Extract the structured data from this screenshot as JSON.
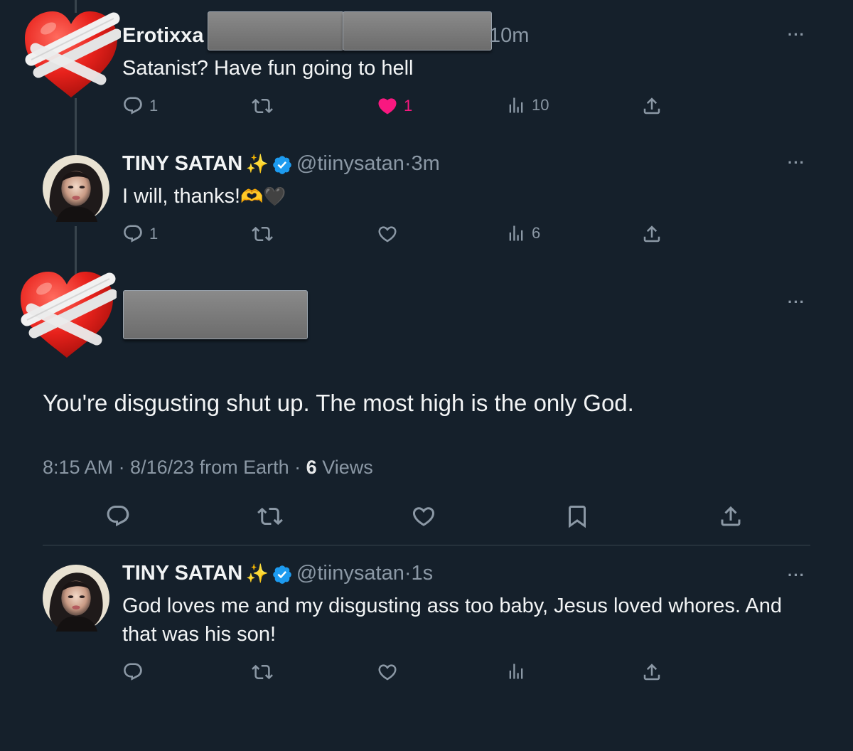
{
  "colors": {
    "background": "#15202b",
    "text": "#e7e9ea",
    "muted": "#8b98a5",
    "like_active": "#f91880",
    "verified": "#1d9bf0",
    "divider": "#38444d"
  },
  "reply1": {
    "name": "Erotixxa",
    "time": "10m",
    "text": "Satanist? Have fun going to hell",
    "replies": "1",
    "likes": "1",
    "views": "10",
    "avatar_icon": "mending-heart-icon"
  },
  "reply2": {
    "name": "TINY SATAN",
    "sparkle": "✨",
    "handle": "@tiinysatan",
    "time": "3m",
    "text": "I will, thanks!",
    "emoji": "🫶🖤",
    "replies": "1",
    "views": "6"
  },
  "main": {
    "text": "You're disgusting shut up. The most high is the only God.",
    "meta_time": "8:15 AM · 8/16/23 from Earth · ",
    "views_count": "6",
    "views_label": " Views",
    "avatar_icon": "mending-heart-icon"
  },
  "reply3": {
    "name": "TINY SATAN",
    "sparkle": "✨",
    "handle": "@tiinysatan",
    "time": "1s",
    "text_line1": "God loves me and my disgusting ass too baby, Jesus loved whores. And",
    "text_line2": "that was his son!"
  },
  "common": {
    "dot": "·",
    "more": "···"
  }
}
